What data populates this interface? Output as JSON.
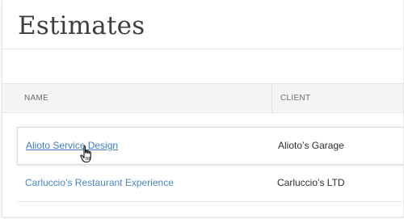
{
  "page": {
    "title": "Estimates"
  },
  "table": {
    "columns": {
      "name": "NAME",
      "client": "CLIENT"
    },
    "rows": [
      {
        "name": "Alioto Service Design",
        "client": "Alioto’s Garage"
      },
      {
        "name": "Carluccio’s Restaurant Experience",
        "client": "Carluccio’s LTD"
      }
    ]
  },
  "cursor": {
    "icon": "hand-pointer-icon"
  },
  "colors": {
    "link": "#4a86c8",
    "header_bg": "#f5f5f5",
    "title": "#3f3f3f"
  }
}
